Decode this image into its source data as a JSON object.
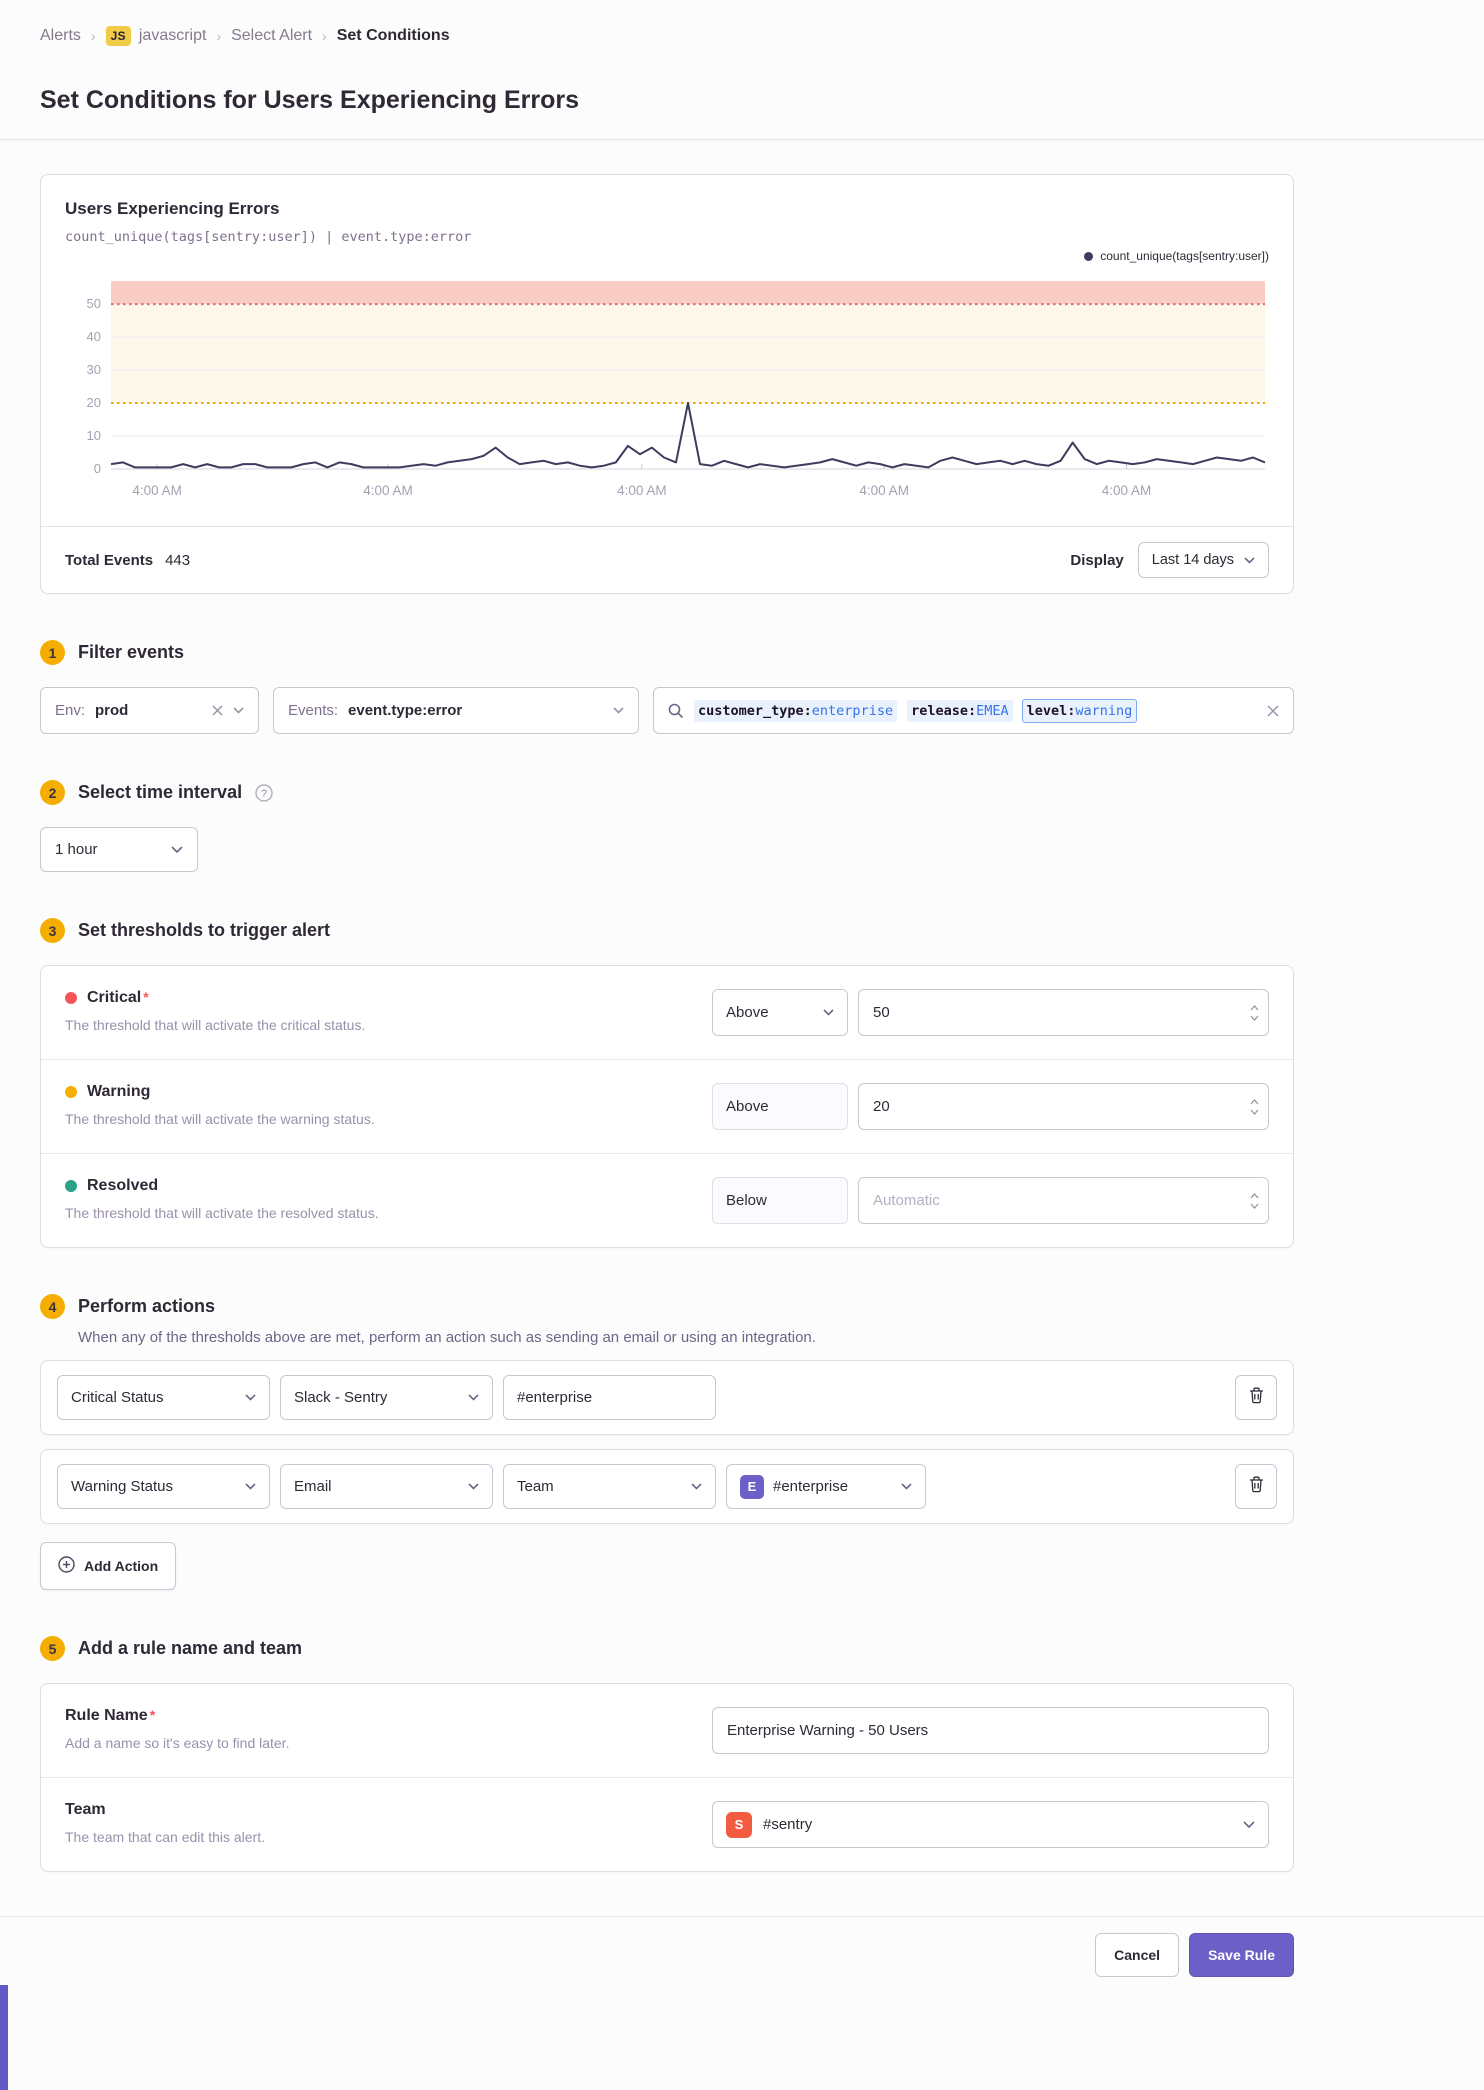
{
  "breadcrumb": {
    "items": [
      "Alerts",
      "javascript",
      "Select Alert",
      "Set Conditions"
    ],
    "project_badge": "JS"
  },
  "page": {
    "title": "Set Conditions for Users Experiencing Errors"
  },
  "chart_panel": {
    "title": "Users Experiencing Errors",
    "query": "count_unique(tags[sentry:user])  |  event.type:error",
    "legend": "count_unique(tags[sentry:user])",
    "total_events_label": "Total Events",
    "total_events_value": "443",
    "display_label": "Display",
    "display_value": "Last 14 days"
  },
  "chart_data": {
    "type": "line",
    "title": "Users Experiencing Errors",
    "ylabel": "",
    "xlabel": "",
    "ylim": [
      0,
      57
    ],
    "yticks": [
      0,
      10,
      20,
      30,
      40,
      50
    ],
    "x_tick_labels": [
      "4:00 AM",
      "4:00 AM",
      "4:00 AM",
      "4:00 AM",
      "4:00 AM"
    ],
    "x_tick_positions": [
      0.04,
      0.24,
      0.46,
      0.67,
      0.88
    ],
    "grid": "subtle-horizontal",
    "legend_position": "top-right",
    "thresholds": {
      "critical_above": 50,
      "warning_above": 20
    },
    "series": [
      {
        "name": "count_unique(tags[sentry:user])",
        "values": [
          1.5,
          2,
          0.5,
          0.5,
          0.5,
          0.5,
          1.5,
          0.5,
          1.5,
          0.5,
          0.5,
          1.5,
          1.5,
          0.5,
          0.5,
          0.5,
          1.5,
          2,
          0.5,
          2,
          1.5,
          0.5,
          0.5,
          0.5,
          0.5,
          1,
          1.5,
          1,
          2,
          2.5,
          3,
          4,
          6.5,
          3.5,
          1.5,
          2,
          2.5,
          1.5,
          2,
          1,
          0.5,
          1,
          2,
          7,
          4.5,
          6.5,
          3.5,
          2,
          20,
          1.5,
          1,
          2.5,
          1.5,
          0.5,
          1.5,
          1,
          0.5,
          1,
          1.5,
          2,
          3,
          2,
          1,
          2,
          1.5,
          0.5,
          1.5,
          1,
          0.5,
          2.5,
          3.5,
          2.5,
          1.5,
          2,
          2.5,
          1.5,
          2.5,
          1.5,
          1,
          2.5,
          8,
          3,
          1.5,
          2.5,
          2,
          1.5,
          2,
          3,
          2.5,
          2,
          1.5,
          2.5,
          3.5,
          3,
          2.5,
          3.5,
          2
        ]
      }
    ],
    "colors": {
      "line": "#3f3b5e",
      "critical_band": "#f9cdc6",
      "warning_band": "#fdf8ea",
      "critical_line": "#ef6266",
      "warning_line": "#f0a500",
      "axis_label": "#a79fb2"
    }
  },
  "sections": {
    "filter": {
      "step": "1",
      "title": "Filter events",
      "env": {
        "label": "Env:",
        "value": "prod"
      },
      "events": {
        "label": "Events:",
        "value": "event.type:error"
      },
      "search_tokens": [
        {
          "key": "customer_type:",
          "value": "enterprise"
        },
        {
          "key": "release:",
          "value": "EMEA"
        },
        {
          "key": "level:",
          "value": "warning"
        }
      ]
    },
    "interval": {
      "step": "2",
      "title": "Select time interval",
      "value": "1 hour"
    },
    "thresholds": {
      "step": "3",
      "title": "Set thresholds to trigger alert",
      "rows": [
        {
          "name": "Critical",
          "description": "The threshold that will activate the critical status.",
          "comparison": "Above",
          "value": "50",
          "placeholder": ""
        },
        {
          "name": "Warning",
          "description": "The threshold that will activate the warning status.",
          "comparison": "Above",
          "value": "20",
          "placeholder": ""
        },
        {
          "name": "Resolved",
          "description": "The threshold that will activate the resolved status.",
          "comparison": "Below",
          "value": "",
          "placeholder": "Automatic"
        }
      ]
    },
    "actions": {
      "step": "4",
      "title": "Perform actions",
      "description": "When any of the thresholds above are met, perform an action such as sending an email or using an integration.",
      "row1": {
        "status": "Critical Status",
        "integration": "Slack - Sentry",
        "target": "#enterprise"
      },
      "row2": {
        "status": "Warning Status",
        "integration": "Email",
        "target_type": "Team",
        "team": "#enterprise",
        "team_badge": "E"
      },
      "add_action_label": "Add Action"
    },
    "naming": {
      "step": "5",
      "title": "Add a rule name and team",
      "rule_name": {
        "label": "Rule Name",
        "description": "Add a name so it's easy to find later.",
        "value": "Enterprise Warning - 50 Users"
      },
      "team": {
        "label": "Team",
        "description": "The team that can edit this alert.",
        "value": "#sentry",
        "badge": "S"
      }
    }
  },
  "footer": {
    "cancel_label": "Cancel",
    "save_label": "Save Rule"
  },
  "status_colors": {
    "critical": "#f55459",
    "warning": "#f5b000",
    "resolved": "#2ba185",
    "accent": "#6c5fc7",
    "team_e_badge": "#6c5fc7",
    "team_s_badge": "#f25b40"
  }
}
